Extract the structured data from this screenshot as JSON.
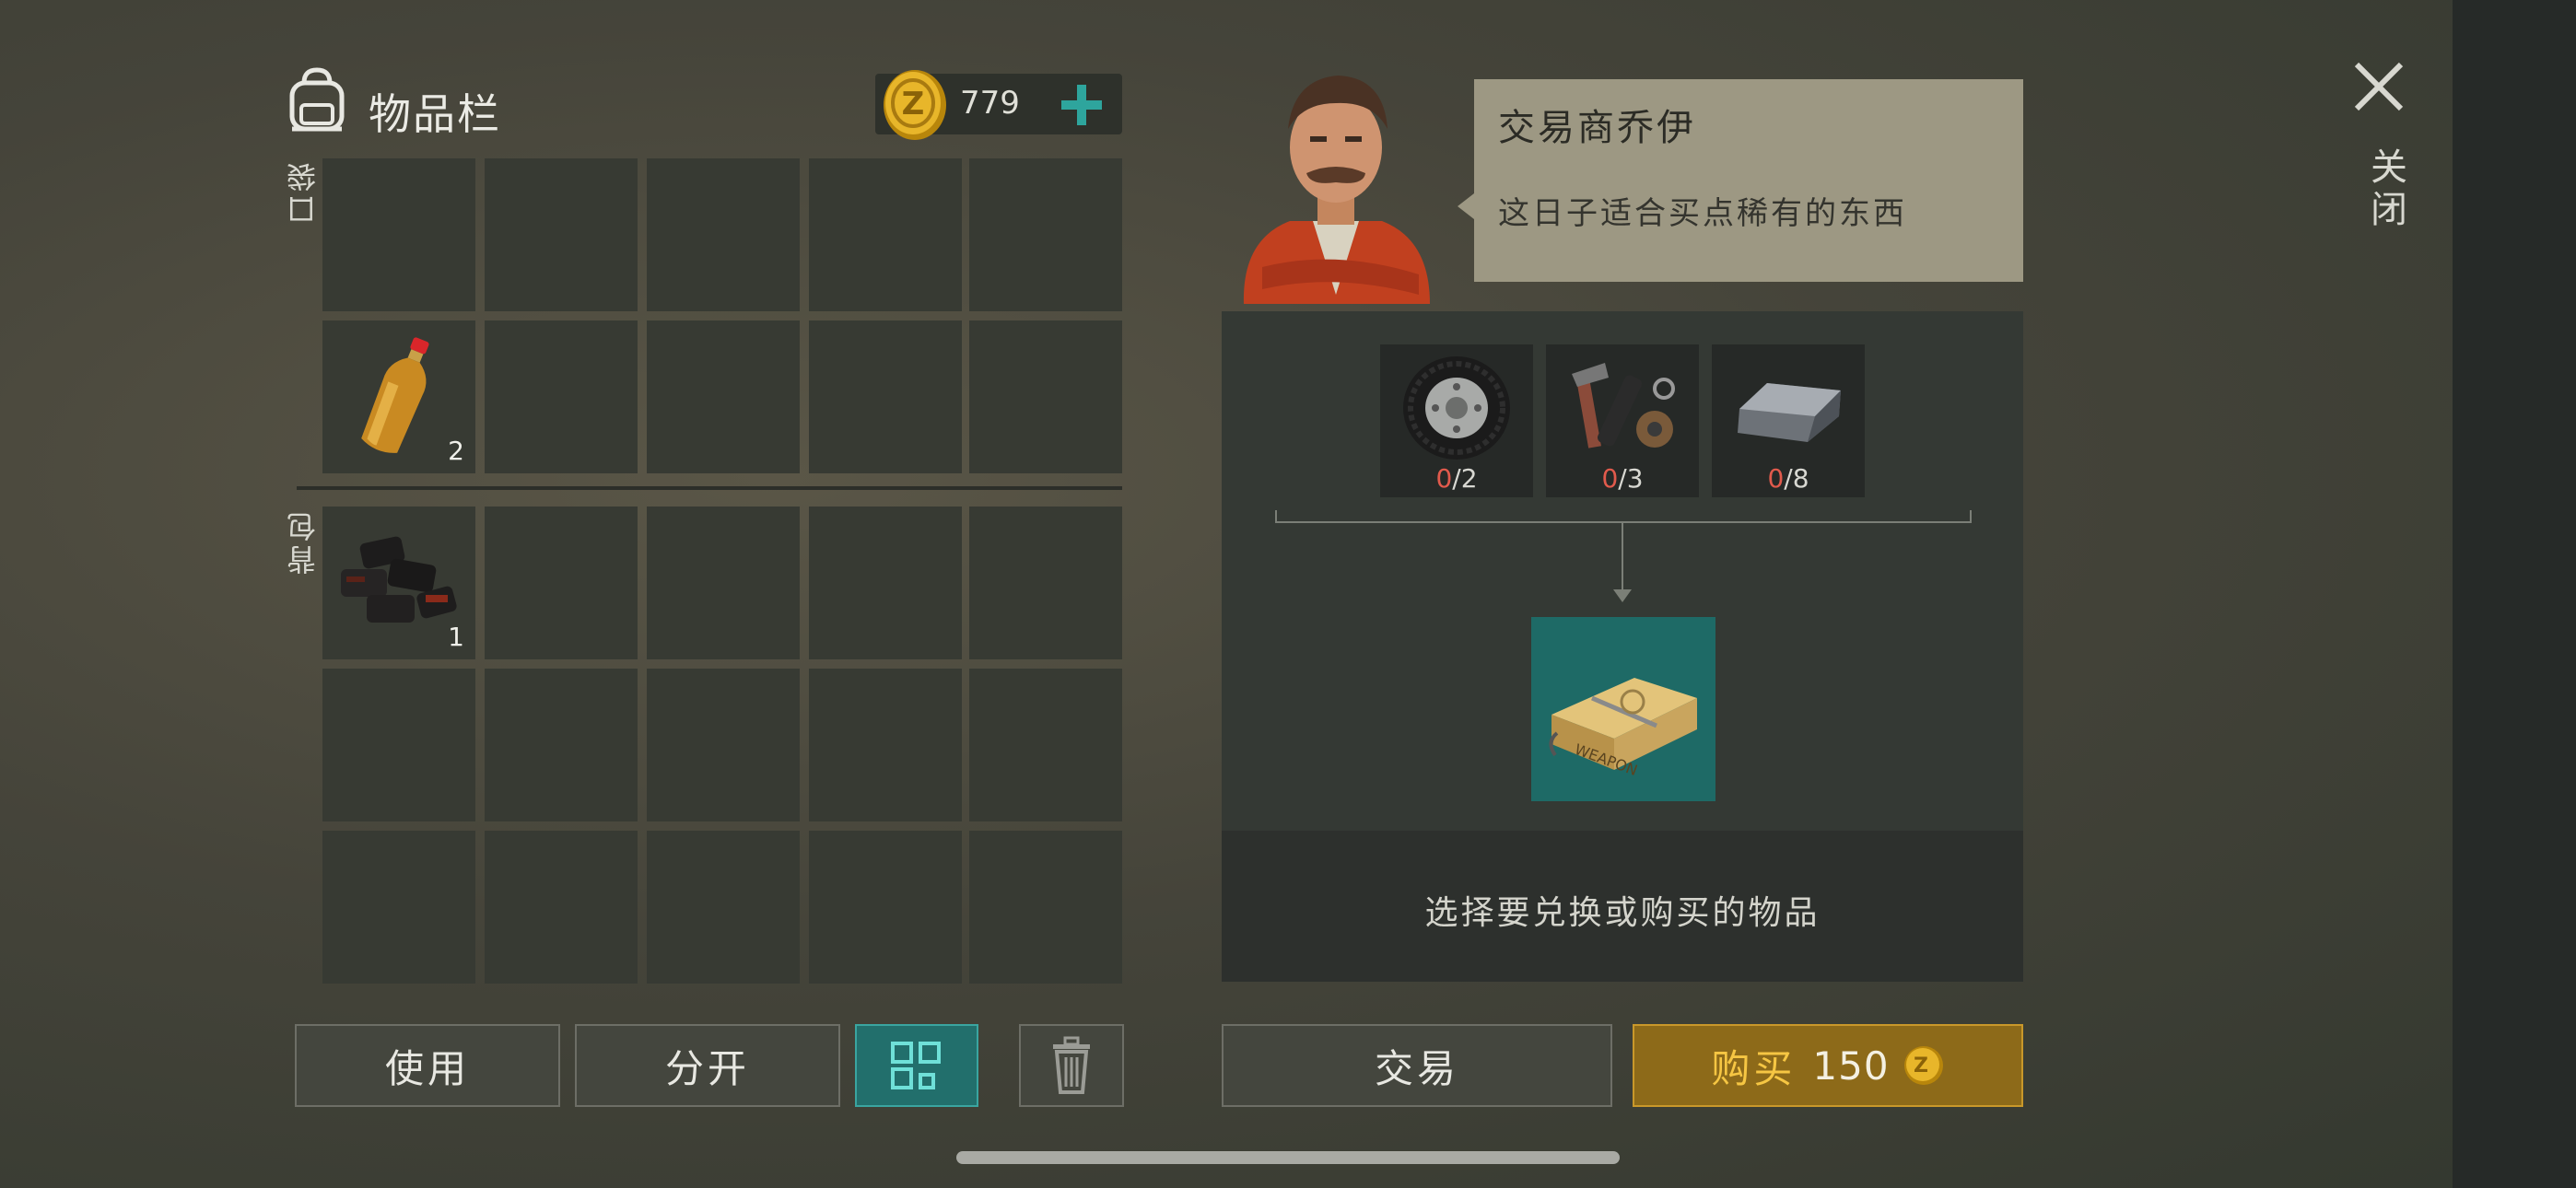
{
  "inventory": {
    "title": "物品栏",
    "coins": "779",
    "pocket_label": "口袋",
    "backpack_label": "背包",
    "items": [
      {
        "name": "bottle",
        "qty": "2"
      },
      {
        "name": "coal",
        "qty": "1"
      }
    ]
  },
  "buttons": {
    "use": "使用",
    "split": "分开",
    "trade": "交易",
    "buy": "购买",
    "buy_price": "150"
  },
  "trader": {
    "name": "交易商乔伊",
    "message": "这日子适合买点稀有的东西"
  },
  "trade": {
    "requirements": [
      {
        "icon": "tire-icon",
        "have": "0",
        "need": "/2"
      },
      {
        "icon": "tools-parts-icon",
        "have": "0",
        "need": "/3"
      },
      {
        "icon": "iron-ingot-icon",
        "have": "0",
        "need": "/8"
      }
    ],
    "result_icon": "weapon-crate-icon",
    "prompt": "选择要兑换或购买的物品"
  },
  "close": {
    "label": "关闭"
  },
  "colors": {
    "accent_teal": "#226f6c",
    "buy_gold": "#8d6a19",
    "deficit_red": "#e15a4c",
    "coin_gold": "#d9a520"
  }
}
